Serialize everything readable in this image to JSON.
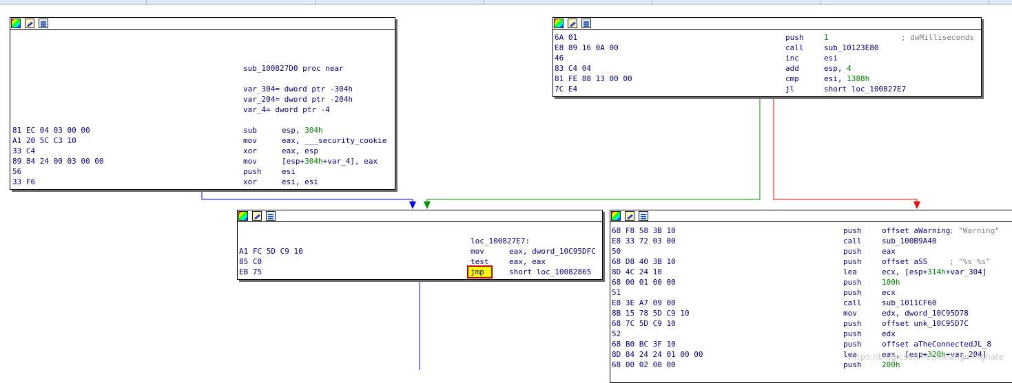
{
  "ui": {
    "accent_blue": "#0000ff",
    "edge_true": "#009000",
    "edge_false": "#ff0000",
    "highlight": "#ffff00"
  },
  "node_a": {
    "toolbar": [
      "color-icon",
      "rename-icon",
      "graph-icon"
    ],
    "proc": "sub_100827D0 proc near",
    "vars": [
      "var_304= dword ptr -304h",
      "var_204= dword ptr -204h",
      "var_4= dword ptr -4"
    ],
    "lines": [
      {
        "bytes": "81 EC 04 03 00 00",
        "mnem": "sub",
        "op1": "esp, ",
        "op2": "304h",
        "op3": ""
      },
      {
        "bytes": "A1 20 5C C3 10",
        "mnem": "mov",
        "op1": "eax, ___security_cookie",
        "op2": "",
        "op3": ""
      },
      {
        "bytes": "33 C4",
        "mnem": "xor",
        "op1": "eax, esp",
        "op2": "",
        "op3": ""
      },
      {
        "bytes": "89 84 24 00 03 00 00",
        "mnem": "mov",
        "op1": "[esp+",
        "op2": "304h",
        "op3": "+var_4], eax"
      },
      {
        "bytes": "56",
        "mnem": "push",
        "op1": "esi",
        "op2": "",
        "op3": ""
      },
      {
        "bytes": "33 F6",
        "mnem": "xor",
        "op1": "esi, esi",
        "op2": "",
        "op3": ""
      }
    ]
  },
  "node_b": {
    "lines": [
      {
        "bytes": "6A 01",
        "mnem": "push",
        "op1": "",
        "op2": "1",
        "op3": "",
        "cmt": "; dwMilliseconds"
      },
      {
        "bytes": "E8 89 16 0A 00",
        "mnem": "call",
        "op1": "sub_10123E80",
        "op2": "",
        "op3": "",
        "cmt": ""
      },
      {
        "bytes": "46",
        "mnem": "inc",
        "op1": "esi",
        "op2": "",
        "op3": "",
        "cmt": ""
      },
      {
        "bytes": "83 C4 04",
        "mnem": "add",
        "op1": "esp, ",
        "op2": "4",
        "op3": "",
        "cmt": ""
      },
      {
        "bytes": "81 FE 88 13 00 00",
        "mnem": "cmp",
        "op1": "esi, ",
        "op2": "1388h",
        "op3": "",
        "cmt": ""
      },
      {
        "bytes": "7C E4",
        "mnem": "jl",
        "op1": "short loc_100827E7",
        "op2": "",
        "op3": "",
        "cmt": ""
      }
    ]
  },
  "node_c": {
    "label": "loc_100827E7:",
    "lines": [
      {
        "bytes": "A1 FC 5D C9 10",
        "mnem": "mov",
        "op1": "eax, dword_10C95DFC"
      },
      {
        "bytes": "85 C0",
        "mnem": "test",
        "op1": "eax, eax"
      },
      {
        "bytes": "EB 75",
        "mnem": "jmp",
        "op1": "short loc_10082865"
      }
    ]
  },
  "node_d": {
    "lines": [
      {
        "bytes": "68 F8 58 3B 10",
        "mnem": "push",
        "op1": "offset aWarning",
        "op2": "",
        "op3": "",
        "cmt": "; \"Warning\""
      },
      {
        "bytes": "E8 33 72 03 00",
        "mnem": "call",
        "op1": "sub_100B9A40",
        "op2": "",
        "op3": "",
        "cmt": ""
      },
      {
        "bytes": "50",
        "mnem": "push",
        "op1": "eax",
        "op2": "",
        "op3": "",
        "cmt": ""
      },
      {
        "bytes": "68 D8 40 3B 10",
        "mnem": "push",
        "op1": "offset aSS",
        "op2": "",
        "op3": "",
        "cmt": "; \"%s %s\""
      },
      {
        "bytes": "8D 4C 24 10",
        "mnem": "lea",
        "op1": "ecx, [esp+",
        "op2": "314h",
        "op3": "+var_304]",
        "cmt": ""
      },
      {
        "bytes": "68 00 01 00 00",
        "mnem": "push",
        "op1": "",
        "op2": "100h",
        "op3": "",
        "cmt": ""
      },
      {
        "bytes": "51",
        "mnem": "push",
        "op1": "ecx",
        "op2": "",
        "op3": "",
        "cmt": ""
      },
      {
        "bytes": "E8 3E A7 09 00",
        "mnem": "call",
        "op1": "sub_1011CF60",
        "op2": "",
        "op3": "",
        "cmt": ""
      },
      {
        "bytes": "8B 15 78 5D C9 10",
        "mnem": "mov",
        "op1": "edx, dword_10C95D78",
        "op2": "",
        "op3": "",
        "cmt": ""
      },
      {
        "bytes": "68 7C 5D C9 10",
        "mnem": "push",
        "op1": "offset unk_10C95D7C",
        "op2": "",
        "op3": "",
        "cmt": ""
      },
      {
        "bytes": "52",
        "mnem": "push",
        "op1": "edx",
        "op2": "",
        "op3": "",
        "cmt": ""
      },
      {
        "bytes": "68 B0 BC 3F 10",
        "mnem": "push",
        "op1": "offset aTheConnectedJL_8",
        "op2": "",
        "op3": "",
        "cmt": " ;"
      },
      {
        "bytes": "8D 84 24 24 01 00 00",
        "mnem": "lea",
        "op1": "eax, [esp+",
        "op2": "328h",
        "op3": "+var_204]",
        "cmt": ""
      },
      {
        "bytes": "68 00 02 00 00",
        "mnem": "push",
        "op1": "",
        "op2": "200h",
        "op3": "",
        "cmt": ""
      }
    ]
  },
  "watermark": "https://blog.csdn.net/lixiangminghate"
}
